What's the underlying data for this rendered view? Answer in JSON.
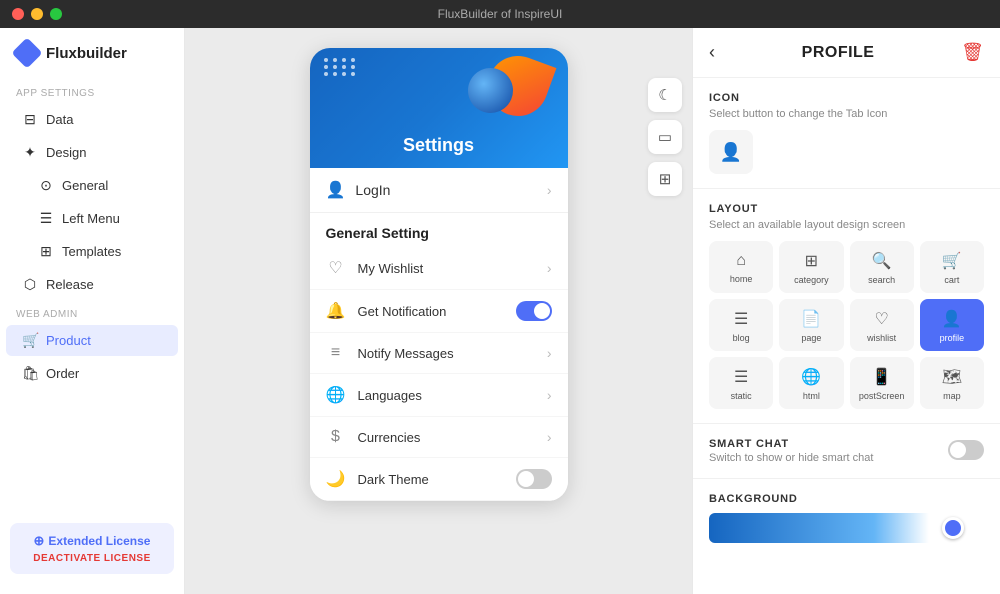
{
  "titleBar": {
    "title": "FluxBuilder of InspireUI"
  },
  "sidebar": {
    "logo": "Fluxbuilder",
    "appSettingsLabel": "App Settings",
    "items": [
      {
        "id": "data",
        "label": "Data",
        "icon": "🗄",
        "sub": false,
        "active": false
      },
      {
        "id": "design",
        "label": "Design",
        "icon": "✏️",
        "sub": false,
        "active": false
      },
      {
        "id": "general",
        "label": "General",
        "icon": "⊙",
        "sub": true,
        "active": false
      },
      {
        "id": "left-menu",
        "label": "Left Menu",
        "icon": "☰",
        "sub": true,
        "active": false
      },
      {
        "id": "templates",
        "label": "Templates",
        "icon": "⊞",
        "sub": true,
        "active": false
      },
      {
        "id": "release",
        "label": "Release",
        "icon": "⬡",
        "sub": false,
        "active": false
      }
    ],
    "webAdminLabel": "Web Admin",
    "webAdminItems": [
      {
        "id": "product",
        "label": "Product",
        "icon": "🛒",
        "active": true
      },
      {
        "id": "order",
        "label": "Order",
        "icon": "🛍",
        "active": false
      }
    ],
    "license": {
      "title": "Extended License",
      "deactivate": "DEACTIVATE LICENSE"
    }
  },
  "phonePreview": {
    "headerTitle": "Settings",
    "loginLabel": "LogIn",
    "generalSettingLabel": "General Setting",
    "menuItems": [
      {
        "id": "wishlist",
        "icon": "♡",
        "label": "My Wishlist",
        "control": "chevron"
      },
      {
        "id": "notification",
        "icon": "🔔",
        "label": "Get Notification",
        "control": "toggle-on"
      },
      {
        "id": "messages",
        "icon": "≡",
        "label": "Notify Messages",
        "control": "chevron"
      },
      {
        "id": "languages",
        "icon": "🌐",
        "label": "Languages",
        "control": "chevron"
      },
      {
        "id": "currencies",
        "icon": "$",
        "label": "Currencies",
        "control": "chevron"
      },
      {
        "id": "darktheme",
        "icon": "🌙",
        "label": "Dark Theme",
        "control": "toggle-off"
      }
    ]
  },
  "sideButtons": [
    {
      "id": "moon",
      "icon": "☾"
    },
    {
      "id": "monitor",
      "icon": "⬜"
    },
    {
      "id": "qr",
      "icon": "⊞"
    }
  ],
  "rightPanel": {
    "title": "PROFILE",
    "iconSection": {
      "title": "ICON",
      "desc": "Select button to change the Tab Icon"
    },
    "layoutSection": {
      "title": "LAYOUT",
      "desc": "Select an available layout design screen",
      "items": [
        {
          "id": "home",
          "icon": "⌂",
          "label": "home",
          "active": false
        },
        {
          "id": "category",
          "icon": "⊞",
          "label": "category",
          "active": false
        },
        {
          "id": "search",
          "icon": "⌕",
          "label": "search",
          "active": false
        },
        {
          "id": "cart",
          "icon": "🛒",
          "label": "cart",
          "active": false
        },
        {
          "id": "blog",
          "icon": "☰",
          "label": "blog",
          "active": false
        },
        {
          "id": "page",
          "icon": "📄",
          "label": "page",
          "active": false
        },
        {
          "id": "wishlist",
          "icon": "♡",
          "label": "wishlist",
          "active": false
        },
        {
          "id": "profile",
          "icon": "👤",
          "label": "profile",
          "active": true
        },
        {
          "id": "static",
          "icon": "☰",
          "label": "static",
          "active": false
        },
        {
          "id": "html",
          "icon": "🌐",
          "label": "html",
          "active": false
        },
        {
          "id": "postscreen",
          "icon": "📱",
          "label": "postScreen",
          "active": false
        },
        {
          "id": "map",
          "icon": "🗺",
          "label": "map",
          "active": false
        }
      ]
    },
    "smartChat": {
      "title": "SMART CHAT",
      "desc": "Switch to show or hide smart chat",
      "enabled": false
    },
    "background": {
      "title": "BACKGROUND"
    }
  }
}
